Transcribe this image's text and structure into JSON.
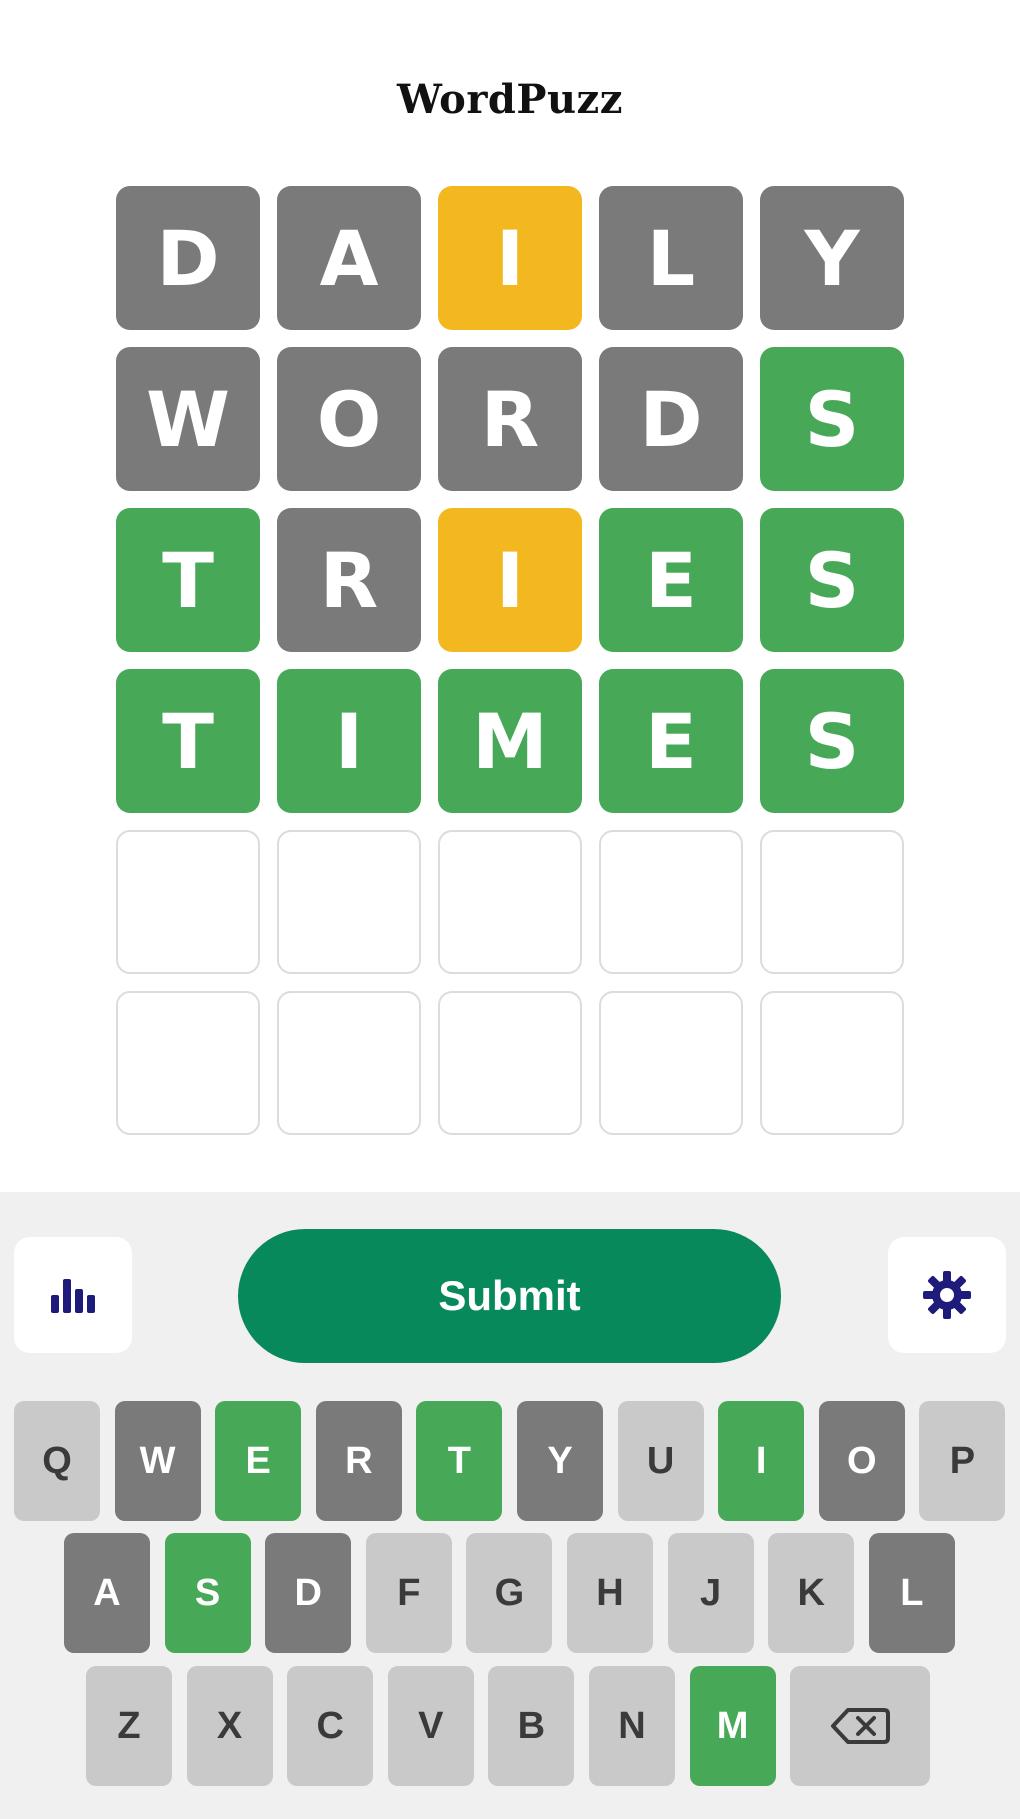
{
  "app": {
    "title": "WordPuzz"
  },
  "board": {
    "rows": [
      [
        {
          "letter": "D",
          "state": "gray"
        },
        {
          "letter": "A",
          "state": "gray"
        },
        {
          "letter": "I",
          "state": "yellow"
        },
        {
          "letter": "L",
          "state": "gray"
        },
        {
          "letter": "Y",
          "state": "gray"
        }
      ],
      [
        {
          "letter": "W",
          "state": "gray"
        },
        {
          "letter": "O",
          "state": "gray"
        },
        {
          "letter": "R",
          "state": "gray"
        },
        {
          "letter": "D",
          "state": "gray"
        },
        {
          "letter": "S",
          "state": "green"
        }
      ],
      [
        {
          "letter": "T",
          "state": "green"
        },
        {
          "letter": "R",
          "state": "gray"
        },
        {
          "letter": "I",
          "state": "yellow"
        },
        {
          "letter": "E",
          "state": "green"
        },
        {
          "letter": "S",
          "state": "green"
        }
      ],
      [
        {
          "letter": "T",
          "state": "green"
        },
        {
          "letter": "I",
          "state": "green"
        },
        {
          "letter": "M",
          "state": "green"
        },
        {
          "letter": "E",
          "state": "green"
        },
        {
          "letter": "S",
          "state": "green"
        }
      ],
      [
        {
          "letter": "",
          "state": "empty"
        },
        {
          "letter": "",
          "state": "empty"
        },
        {
          "letter": "",
          "state": "empty"
        },
        {
          "letter": "",
          "state": "empty"
        },
        {
          "letter": "",
          "state": "empty"
        }
      ],
      [
        {
          "letter": "",
          "state": "empty"
        },
        {
          "letter": "",
          "state": "empty"
        },
        {
          "letter": "",
          "state": "empty"
        },
        {
          "letter": "",
          "state": "empty"
        },
        {
          "letter": "",
          "state": "empty"
        }
      ]
    ]
  },
  "toolbar": {
    "submit_label": "Submit",
    "stats_icon": "bar-chart-icon",
    "settings_icon": "gear-icon"
  },
  "keyboard": {
    "rows": [
      [
        {
          "key": "Q",
          "state": "unused"
        },
        {
          "key": "W",
          "state": "gray"
        },
        {
          "key": "E",
          "state": "green"
        },
        {
          "key": "R",
          "state": "gray"
        },
        {
          "key": "T",
          "state": "green"
        },
        {
          "key": "Y",
          "state": "gray"
        },
        {
          "key": "U",
          "state": "unused"
        },
        {
          "key": "I",
          "state": "green"
        },
        {
          "key": "O",
          "state": "gray"
        },
        {
          "key": "P",
          "state": "unused"
        }
      ],
      [
        {
          "key": "A",
          "state": "gray"
        },
        {
          "key": "S",
          "state": "green"
        },
        {
          "key": "D",
          "state": "gray"
        },
        {
          "key": "F",
          "state": "unused"
        },
        {
          "key": "G",
          "state": "unused"
        },
        {
          "key": "H",
          "state": "unused"
        },
        {
          "key": "J",
          "state": "unused"
        },
        {
          "key": "K",
          "state": "unused"
        },
        {
          "key": "L",
          "state": "gray"
        }
      ],
      [
        {
          "key": "Z",
          "state": "unused"
        },
        {
          "key": "X",
          "state": "unused"
        },
        {
          "key": "C",
          "state": "unused"
        },
        {
          "key": "V",
          "state": "unused"
        },
        {
          "key": "B",
          "state": "unused"
        },
        {
          "key": "N",
          "state": "unused"
        },
        {
          "key": "M",
          "state": "green"
        },
        {
          "key": "",
          "state": "unused",
          "icon": "backspace-icon"
        }
      ]
    ]
  },
  "colors": {
    "gray": "#7a7a7a",
    "yellow": "#f3b81f",
    "green": "#47a958",
    "submit": "#07895b",
    "icon": "#1e1b7a",
    "key_unused": "#c9c9c9"
  }
}
